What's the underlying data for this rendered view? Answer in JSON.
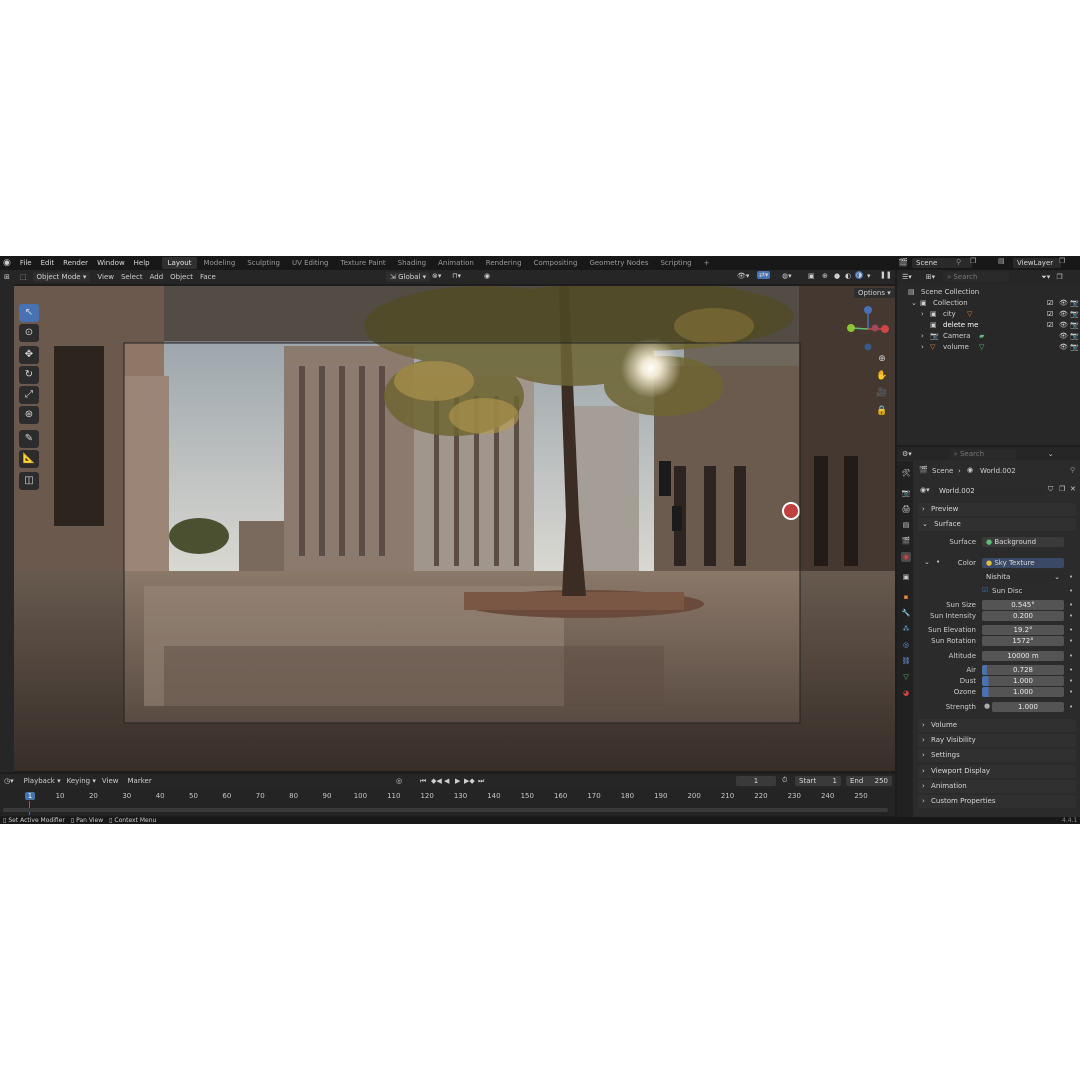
{
  "menu": {
    "items": [
      "File",
      "Edit",
      "Render",
      "Window",
      "Help"
    ]
  },
  "workspaces": {
    "tabs": [
      "Layout",
      "Modeling",
      "Sculpting",
      "UV Editing",
      "Texture Paint",
      "Shading",
      "Animation",
      "Rendering",
      "Compositing",
      "Geometry Nodes",
      "Scripting"
    ],
    "active": "Layout",
    "add": "+"
  },
  "scene": {
    "name": "Scene",
    "view_layer": "ViewLayer"
  },
  "viewport_header": {
    "mode": "Object Mode",
    "items": [
      "View",
      "Select",
      "Add",
      "Object",
      "Face"
    ],
    "transform": "Global",
    "options": "Options"
  },
  "outliner": {
    "search_placeholder": "Search",
    "root": "Scene Collection",
    "items": [
      {
        "label": "Collection"
      },
      {
        "label": "city"
      },
      {
        "label": "delete me"
      },
      {
        "label": "Camera"
      },
      {
        "label": "volume"
      }
    ]
  },
  "properties": {
    "search_placeholder": "Search",
    "breadcrumb_scene": "Scene",
    "breadcrumb_world": "World.002",
    "world_name": "World.002",
    "panels": {
      "preview": "Preview",
      "surface": "Surface",
      "volume": "Volume",
      "ray_visibility": "Ray Visibility",
      "settings": "Settings",
      "viewport_display": "Viewport Display",
      "animation": "Animation",
      "custom_properties": "Custom Properties"
    },
    "surface_label": "Surface",
    "surface_value": "Background",
    "color_label": "Color",
    "color_value": "Sky Texture",
    "sky_type": "Nishita",
    "sun_disc": "Sun Disc",
    "fields": [
      {
        "label": "Sun Size",
        "value": "0.545°"
      },
      {
        "label": "Sun Intensity",
        "value": "0.200"
      },
      {
        "label": "Sun Elevation",
        "value": "19.2°"
      },
      {
        "label": "Sun Rotation",
        "value": "1572°"
      },
      {
        "label": "Altitude",
        "value": "10000 m"
      },
      {
        "label": "Air",
        "value": "0.728"
      },
      {
        "label": "Dust",
        "value": "1.000"
      },
      {
        "label": "Ozone",
        "value": "1.000"
      },
      {
        "label": "Strength",
        "value": "1.000"
      }
    ]
  },
  "timeline": {
    "menus": [
      "Playback",
      "Keying",
      "View",
      "Marker"
    ],
    "current_frame": "1",
    "start_label": "Start",
    "start": "1",
    "end_label": "End",
    "end": "250",
    "ticks": [
      "1",
      "10",
      "20",
      "30",
      "40",
      "50",
      "60",
      "70",
      "80",
      "90",
      "100",
      "110",
      "120",
      "130",
      "140",
      "150",
      "160",
      "170",
      "180",
      "190",
      "200",
      "210",
      "220",
      "230",
      "240",
      "250"
    ]
  },
  "status": {
    "items": [
      "Set Active Modifier",
      "Pan View",
      "Context Menu"
    ],
    "version": "4.4.1"
  },
  "colors": {
    "accent": "#4772b3",
    "active_frame": "#4772b3",
    "orange": "#e0883a",
    "green": "#5bbf73"
  }
}
